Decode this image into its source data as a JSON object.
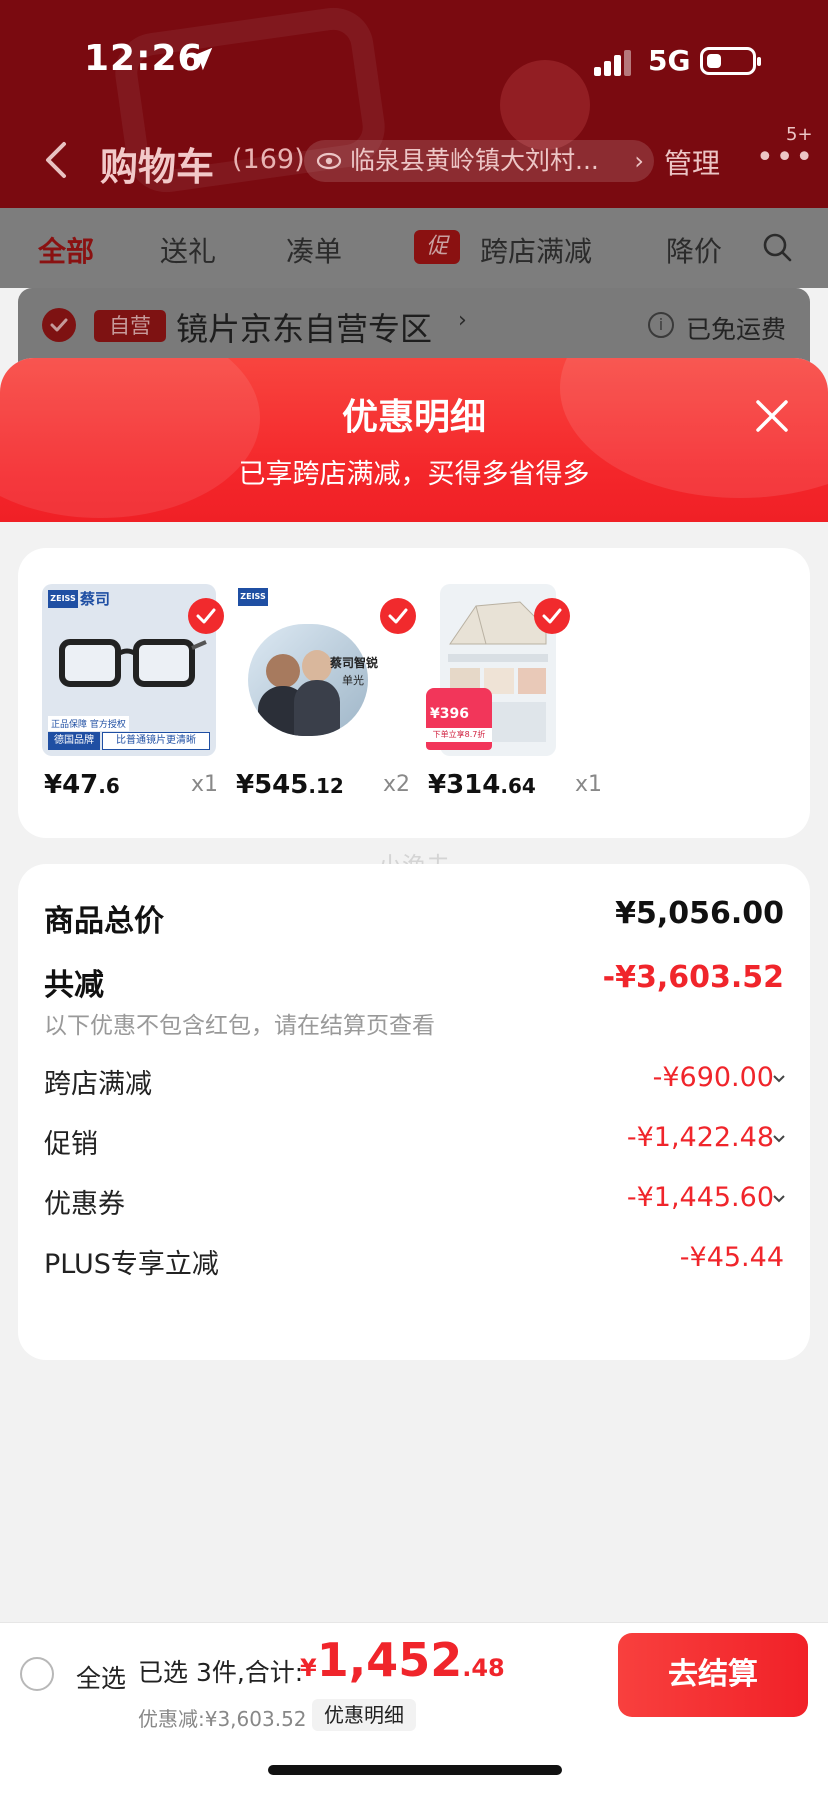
{
  "status_bar": {
    "time": "12:26",
    "network": "5G"
  },
  "nav": {
    "title": "购物车",
    "count": "(169)",
    "address": "临泉县黄岭镇大刘村...",
    "manage": "管理",
    "more_badge": "5+"
  },
  "tabs": [
    {
      "label": "全部",
      "active": true
    },
    {
      "label": "送礼"
    },
    {
      "label": "凑单"
    },
    {
      "label": "跨店满减",
      "badge": "促"
    },
    {
      "label": "降价"
    }
  ],
  "shop": {
    "badge": "自营",
    "name": "镜片京东自营专区",
    "shipping": "已免运费"
  },
  "sheet": {
    "title": "优惠明细",
    "subtitle": "已享跨店满减，买得多省得多"
  },
  "products": [
    {
      "price_int": "¥47",
      "price_dec": ".6",
      "qty": "x1",
      "thumb_text": [
        "蔡司",
        "德国品牌",
        "比普通镜片更清晰",
        "正品保障 官方授权"
      ]
    },
    {
      "price_int": "¥545",
      "price_dec": ".12",
      "qty": "x2",
      "thumb_text": [
        "蔡司智锐",
        "单光"
      ]
    },
    {
      "price_int": "¥314",
      "price_dec": ".64",
      "qty": "x1",
      "thumb_text": [
        "¥396",
        "下单立享8.7折"
      ]
    }
  ],
  "watermark": "小渔夫",
  "summary": {
    "total_label": "商品总价",
    "total_value": "¥5,056.00",
    "reduce_label": "共减",
    "reduce_value": "-¥3,603.52",
    "note": "以下优惠不包含红包，请在结算页查看",
    "items": [
      {
        "label": "跨店满减",
        "value": "-¥690.00",
        "expandable": true
      },
      {
        "label": "促销",
        "value": "-¥1,422.48",
        "expandable": true
      },
      {
        "label": "优惠券",
        "value": "-¥1,445.60",
        "expandable": true
      },
      {
        "label": "PLUS专享立减",
        "value": "-¥45.44",
        "expandable": false
      }
    ]
  },
  "bottom": {
    "select_all": "全选",
    "selected_text": "已选 3件,合计:",
    "total_currency": "¥",
    "total_int": "1,452",
    "total_dec": ".48",
    "discount_text": "优惠减:¥3,603.52",
    "detail_chip": "优惠明细",
    "checkout": "去结算"
  },
  "colors": {
    "accent": "#f0252b",
    "header_dim": "#7a0a10"
  }
}
